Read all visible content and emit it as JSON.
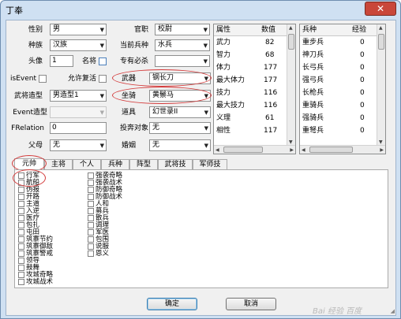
{
  "window": {
    "title": "丁奉",
    "close_label": "✕"
  },
  "form": {
    "gender": {
      "label": "性别",
      "value": "男"
    },
    "official": {
      "label": "官职",
      "value": "校尉"
    },
    "race": {
      "label": "种族",
      "value": "汉族"
    },
    "troop": {
      "label": "当前兵种",
      "value": "水兵"
    },
    "portrait": {
      "label": "头像",
      "value": "1"
    },
    "famous_label": "名将",
    "must_kill_label": "专有必杀",
    "must_kill_value": "",
    "is_event_label": "isEvent",
    "allow_revive_label": "允许复活",
    "weapon": {
      "label": "武器",
      "value": "钢长刀"
    },
    "general_model": {
      "label": "武将造型",
      "value": "男造型1"
    },
    "mount": {
      "label": "坐骑",
      "value": "黄鬃马"
    },
    "event_model": {
      "label": "Event造型",
      "value": ""
    },
    "item": {
      "label": "道具",
      "value": "幻世录II"
    },
    "frelation": {
      "label": "FRelation",
      "value": "0"
    },
    "defect_target": {
      "label": "投奔对象",
      "value": "无"
    },
    "father": {
      "label": "父母",
      "value": "无"
    },
    "spouse": {
      "label": "婚姻",
      "value": "无"
    }
  },
  "attr_table": {
    "headers": [
      "属性",
      "数值"
    ],
    "rows": [
      [
        "武力",
        "82"
      ],
      [
        "智力",
        "68"
      ],
      [
        "体力",
        "177"
      ],
      [
        "最大体力",
        "177"
      ],
      [
        "技力",
        "116"
      ],
      [
        "最大技力",
        "116"
      ],
      [
        "义理",
        "61"
      ],
      [
        "相性",
        "117"
      ]
    ]
  },
  "troop_table": {
    "headers": [
      "兵种",
      "经验"
    ],
    "rows": [
      [
        "重步兵",
        "0"
      ],
      [
        "神刀兵",
        "0"
      ],
      [
        "长弓兵",
        "0"
      ],
      [
        "强弓兵",
        "0"
      ],
      [
        "长枪兵",
        "0"
      ],
      [
        "重骑兵",
        "0"
      ],
      [
        "强骑兵",
        "0"
      ],
      [
        "重弩兵",
        "0"
      ]
    ]
  },
  "tabs": [
    "元帅",
    "主将",
    "个人",
    "兵种",
    "阵型",
    "武将技",
    "军师技"
  ],
  "skills_col1": [
    "行军",
    "航船",
    "伪报",
    "开路",
    "主道",
    "入逆",
    "医疗",
    "包扎",
    "屯田",
    "筑寨节约",
    "筑寨御敌",
    "筑寨警戒",
    "领导",
    "鼓舞",
    "攻城奇略",
    "攻城战术"
  ],
  "skills_col2": [
    "强袭奇略",
    "强袭战术",
    "防御奇略",
    "防御战术",
    "人和",
    "募兵",
    "散兵",
    "调理",
    "军医",
    "包围",
    "说服",
    "恩义"
  ],
  "buttons": {
    "ok": "确定",
    "cancel": "取消"
  },
  "watermark": "Bai 经验 百度"
}
